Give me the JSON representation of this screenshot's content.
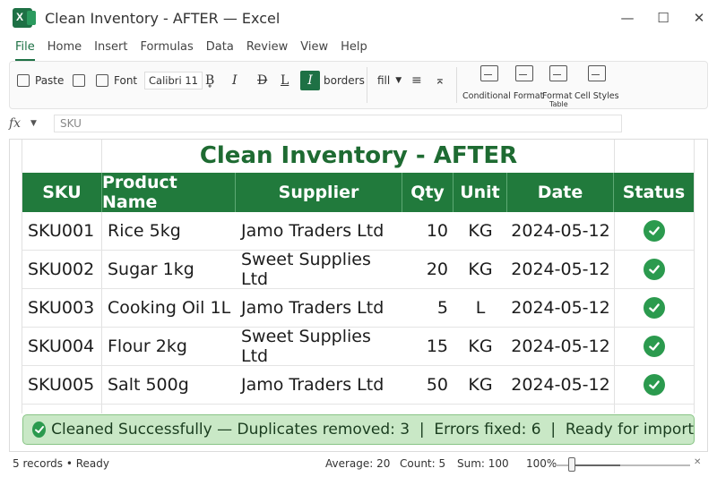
{
  "window": {
    "title": "Clean Inventory - AFTER — Excel",
    "controls": [
      "—",
      "☐",
      "✕"
    ]
  },
  "menu": [
    "File",
    "Home",
    "Insert",
    "Formulas",
    "Data",
    "Review",
    "View",
    "Help"
  ],
  "ribbon": {
    "paste": "Paste",
    "font_label": "Font",
    "font_value": "Calibri 11",
    "borders": "borders",
    "fill": "fill",
    "conditional_format": "Conditional Format",
    "format_table_line1": "Format",
    "format_table_line2": "Table",
    "cell_styles": "Cell Styles"
  },
  "formula_bar": {
    "fx": "fx",
    "value": "SKU"
  },
  "sheet": {
    "title": "Clean Inventory - AFTER",
    "headers": [
      "SKU",
      "Product Name",
      "Supplier",
      "Qty",
      "Unit",
      "Date",
      "Status"
    ],
    "rows": [
      {
        "sku": "SKU001",
        "product": "Rice 5kg",
        "supplier": "Jamo Traders Ltd",
        "qty": "10",
        "unit": "KG",
        "date": "2024-05-12"
      },
      {
        "sku": "SKU002",
        "product": "Sugar 1kg",
        "supplier": "Sweet Supplies Ltd",
        "qty": "20",
        "unit": "KG",
        "date": "2024-05-12"
      },
      {
        "sku": "SKU003",
        "product": "Cooking Oil 1L",
        "supplier": "Jamo Traders Ltd",
        "qty": "5",
        "unit": "L",
        "date": "2024-05-12"
      },
      {
        "sku": "SKU004",
        "product": "Flour 2kg",
        "supplier": "Sweet Supplies Ltd",
        "qty": "15",
        "unit": "KG",
        "date": "2024-05-12"
      },
      {
        "sku": "SKU005",
        "product": "Salt 500g",
        "supplier": "Jamo Traders Ltd",
        "qty": "50",
        "unit": "KG",
        "date": "2024-05-12"
      }
    ],
    "banner": "Cleaned Successfully — Duplicates removed: 3  |  Errors fixed: 6  |  Ready for import"
  },
  "status": {
    "left": "5 records • Ready",
    "average": "Average: 20",
    "count": "Count: 5",
    "sum": "Sum: 100",
    "zoom": "100%",
    "zoom_level": 1.0
  },
  "colors": {
    "accent": "#1e7145",
    "header_green": "#217a3c",
    "title_green": "#1e6b32",
    "check_green": "#2b9a4e",
    "banner_bg": "#c9e8c6"
  }
}
